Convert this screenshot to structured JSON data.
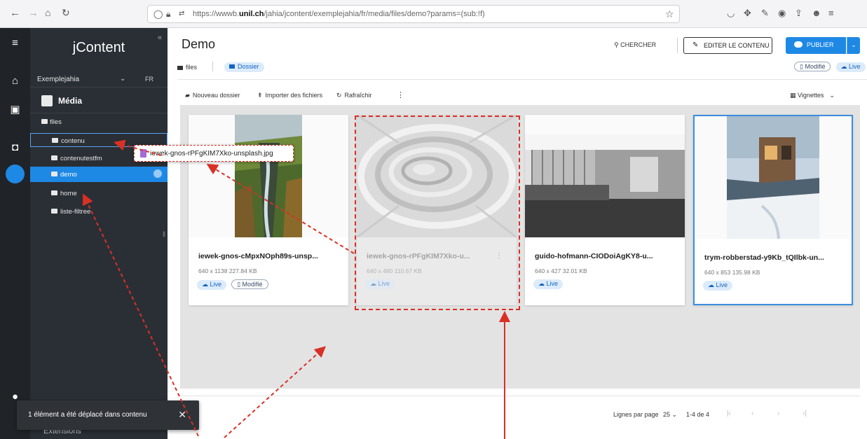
{
  "browser": {
    "url_prefix": "https://wwwb.",
    "url_domain": "unil.ch",
    "url_suffix": "/jahia/jcontent/exemplejahia/fr/media/files/demo?params=(sub:!f)"
  },
  "sidebar": {
    "brand": "jContent",
    "site": "Exemplejahia",
    "language": "FR",
    "section": "Média",
    "tree": [
      {
        "label": "files"
      },
      {
        "label": "contenu"
      },
      {
        "label": "contenutestfm"
      },
      {
        "label": "demo"
      },
      {
        "label": "home"
      },
      {
        "label": "liste-filtree"
      }
    ],
    "extensions": "Extensions"
  },
  "drag_ghost": {
    "filename": "iewek-gnos-rPFgKIM7Xko-unsplash.jpg"
  },
  "snackbar": {
    "message": "1 élément a été déplacé dans contenu"
  },
  "header": {
    "title": "Demo",
    "breadcrumb_files": "files",
    "breadcrumb_folder": "Dossier",
    "search": "CHERCHER",
    "edit": "EDITER LE CONTENU",
    "publish": "PUBLIER",
    "status_modified": "Modifié",
    "status_live": "Live"
  },
  "toolbar": {
    "new_folder": "Nouveau dossier",
    "upload": "Importer des fichiers",
    "refresh": "Rafraîchir",
    "view": "Vignettes"
  },
  "cards": [
    {
      "name": "iewek-gnos-cMpxNOph89s-unsp...",
      "dims": "640 x 1138",
      "size": "227.84 KB",
      "live": "Live",
      "modified": "Modifié"
    },
    {
      "name": "iewek-gnos-rPFgKIM7Xko-u...",
      "dims": "640 x 480",
      "size": "110.67 KB",
      "live": "Live"
    },
    {
      "name": "guido-hofmann-CIODoiAgKY8-u...",
      "dims": "640 x 427",
      "size": "32.01 KB",
      "live": "Live"
    },
    {
      "name": "trym-robberstad-y9Kb_tQIlbk-un...",
      "dims": "640 x 853",
      "size": "135.98 KB",
      "live": "Live"
    }
  ],
  "pagination": {
    "rows_label": "Lignes par page",
    "rows_value": "25",
    "range": "1-4 de 4"
  },
  "colors": {
    "accent": "#1e88e5",
    "rail": "#202428",
    "sidebar": "#2a2f35",
    "annotation": "#d93025"
  }
}
